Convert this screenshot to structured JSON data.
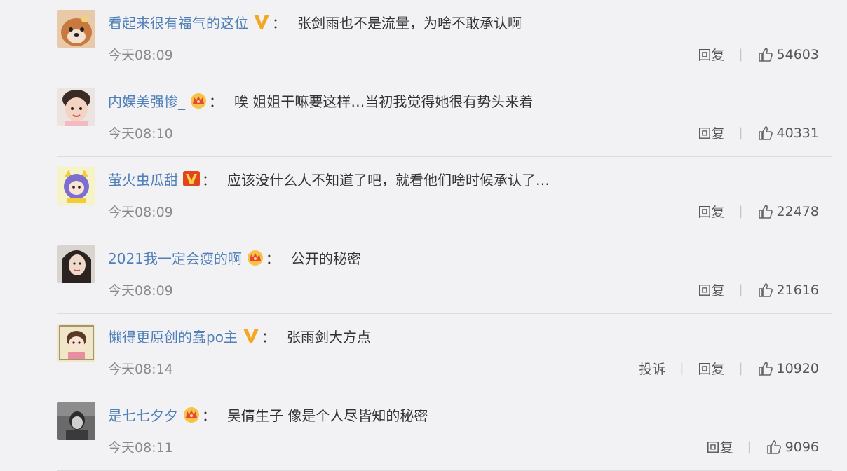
{
  "comments": [
    {
      "user": "看起来很有福气的这位",
      "badge": "v-gold-icon",
      "content": "张剑雨也不是流量，为啥不敢承认啊",
      "time": "今天08:09",
      "report": "",
      "reply": "回复",
      "likes": "54603",
      "avatar": "shiba-dog-avatar"
    },
    {
      "user": "内娱美强惨_",
      "badge": "crown-icon",
      "content": "唉 姐姐干嘛要这样…当初我觉得她很有势头来着",
      "time": "今天08:10",
      "report": "",
      "reply": "回复",
      "likes": "40331",
      "avatar": "child-avatar"
    },
    {
      "user": "萤火虫瓜甜",
      "badge": "v-red-icon",
      "content": "应该没什么人不知道了吧，就看他们啥时候承认了…",
      "time": "今天08:09",
      "report": "",
      "reply": "回复",
      "likes": "22478",
      "avatar": "purple-cartoon-avatar"
    },
    {
      "user": "2021我一定会瘦的啊",
      "badge": "crown-icon",
      "content": "公开的秘密",
      "time": "今天08:09",
      "report": "",
      "reply": "回复",
      "likes": "21616",
      "avatar": "woman-avatar"
    },
    {
      "user": "懒得更原创的蠢po主",
      "badge": "v-gold-icon",
      "content": "张雨剑大方点",
      "time": "今天08:14",
      "report": "投诉",
      "reply": "回复",
      "likes": "10920",
      "avatar": "cartoon-girl-avatar"
    },
    {
      "user": "是七七夕夕",
      "badge": "crown-icon",
      "content": "吴倩生子 像是个人尽皆知的秘密",
      "time": "今天08:11",
      "report": "",
      "reply": "回复",
      "likes": "9096",
      "avatar": "dark-photo-avatar"
    }
  ],
  "colors": {
    "username": "#4f7fb8",
    "background": "#f2f2f5",
    "badge_gold": "#f5a623",
    "badge_red": "#e0451f"
  }
}
